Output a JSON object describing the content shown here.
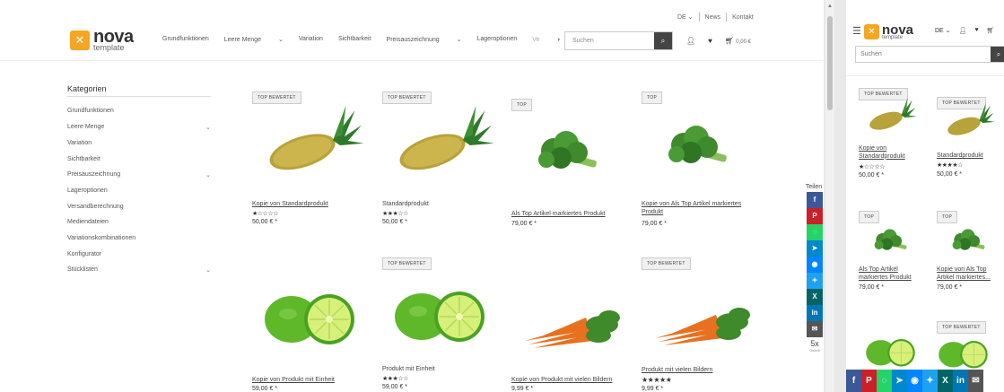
{
  "top_links": {
    "lang": "DE",
    "news": "News",
    "contact": "Kontakt"
  },
  "logo": {
    "name": "nova",
    "sub": "template"
  },
  "nav": [
    "Grundfunktionen",
    "Leere Menge",
    "Variation",
    "Sichtbarkeit",
    "Preisauszeichnung",
    "Lageroptionen",
    "Ve"
  ],
  "search": {
    "placeholder": "Suchen"
  },
  "cart": {
    "total": "0,00 €"
  },
  "sidebar": {
    "title": "Kategorien",
    "items": [
      "Grundfunktionen",
      "Leere Menge",
      "Variation",
      "Sichtbarkeit",
      "Preisauszeichnung",
      "Lageroptionen",
      "Versandberechnung",
      "Mediendateien",
      "Variationskombinationen",
      "Konfigurator",
      "Stücklisten"
    ]
  },
  "products": [
    {
      "badge": "TOP BEWERTET",
      "name": "Kopie von Standardprodukt",
      "stars": "★☆☆☆☆",
      "price": "50,00 € *",
      "img": "pineapple"
    },
    {
      "badge": "TOP BEWERTET",
      "name": "Standardprodukt",
      "stars": "★★★☆☆",
      "price": "50,00 € *",
      "img": "pineapple"
    },
    {
      "badge": "TOP",
      "name": "Als Top Artikel markiertes Produkt",
      "stars": "",
      "price": "79,00 € *",
      "img": "broccoli"
    },
    {
      "badge": "TOP",
      "name": "Kopie von Als Top Artikel markiertes Produkt",
      "stars": "",
      "price": "79,00 € *",
      "img": "broccoli"
    },
    {
      "badge": "",
      "name": "Kopie von Produkt mit Einheit",
      "stars": "",
      "price": "59,00 € *",
      "img": "lime"
    },
    {
      "badge": "TOP BEWERTET",
      "name": "Produkt mit Einheit",
      "stars": "★★★☆☆",
      "price": "59,00 € *",
      "img": "lime"
    },
    {
      "badge": "",
      "name": "Kopie von Produkt mit vielen Bildern",
      "stars": "",
      "price": "9,99 € *",
      "img": "carrot"
    },
    {
      "badge": "TOP BEWERTET",
      "name": "Produkt mit vielen Bildern",
      "stars": "★★★★★",
      "price": "9,99 € *",
      "img": "carrot"
    }
  ],
  "share": {
    "label": "Teilen",
    "count": "5x",
    "count_label": "Geteilt"
  },
  "mobile": {
    "lang": "DE",
    "search_placeholder": "Suchen",
    "products": [
      {
        "badge": "TOP BEWERTET",
        "name": "Kopie von Standardprodukt",
        "stars": "★☆☆☆☆",
        "price": "50,00 € *"
      },
      {
        "badge": "TOP BEWERTET",
        "name": "Standardprodukt",
        "stars": "★★★★☆",
        "price": "50,00 € *"
      },
      {
        "badge": "TOP",
        "name": "Als Top Artikel markiertes Produkt",
        "stars": "",
        "price": "79,00 € *"
      },
      {
        "badge": "TOP",
        "name": "Kopie von Als Top Artikel markiertes...",
        "stars": "",
        "price": "79,00 € *"
      },
      {
        "badge": "",
        "name": "",
        "stars": "",
        "price": ""
      },
      {
        "badge": "TOP BEWERTET",
        "name": "",
        "stars": "",
        "price": ""
      }
    ]
  },
  "colors": {
    "accent": "#f5a623",
    "facebook": "#3b5998",
    "pinterest": "#cb2027",
    "whatsapp": "#25d366",
    "telegram": "#0088cc",
    "messenger": "#0084ff",
    "twitter": "#1da1f2",
    "xing": "#026466",
    "linkedin": "#0077b5",
    "email": "#555555"
  }
}
